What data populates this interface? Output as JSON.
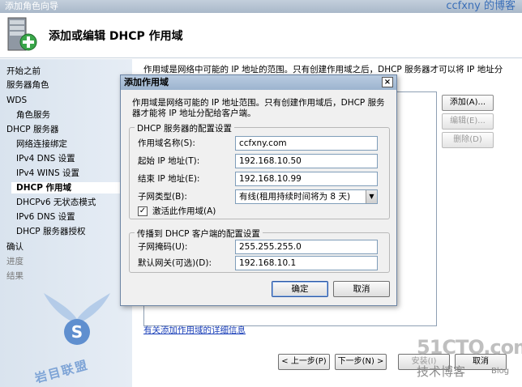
{
  "window": {
    "title": "添加角色向导",
    "watermark_top": "ccfxny 的博客"
  },
  "header": {
    "title": "添加或编辑 DHCP 作用域",
    "icon": "server-add-icon"
  },
  "nav": {
    "items": [
      {
        "label": "开始之前",
        "level": "top",
        "state": "normal"
      },
      {
        "label": "服务器角色",
        "level": "top",
        "state": "normal"
      },
      {
        "label": "WDS",
        "level": "top",
        "state": "normal"
      },
      {
        "label": "角色服务",
        "level": "sub",
        "state": "normal"
      },
      {
        "label": "DHCP 服务器",
        "level": "top",
        "state": "normal"
      },
      {
        "label": "网络连接绑定",
        "level": "sub",
        "state": "normal"
      },
      {
        "label": "IPv4 DNS 设置",
        "level": "sub",
        "state": "normal"
      },
      {
        "label": "IPv4 WINS 设置",
        "level": "sub",
        "state": "normal"
      },
      {
        "label": "DHCP 作用域",
        "level": "sub",
        "state": "active"
      },
      {
        "label": "DHCPv6 无状态模式",
        "level": "sub",
        "state": "normal"
      },
      {
        "label": "IPv6 DNS 设置",
        "level": "sub",
        "state": "normal"
      },
      {
        "label": "DHCP 服务器授权",
        "level": "sub",
        "state": "normal"
      },
      {
        "label": "确认",
        "level": "top",
        "state": "normal"
      },
      {
        "label": "进度",
        "level": "top",
        "state": "dim"
      },
      {
        "label": "结果",
        "level": "top",
        "state": "dim"
      }
    ]
  },
  "content": {
    "intro": "作用域是网络中可能的 IP 地址的范围。只有创建作用域之后，DHCP 服务器才可以将 IP 地址分",
    "buttons": {
      "add": "添加(A)...",
      "edit": "编辑(E)...",
      "delete": "删除(D)"
    },
    "more_link": "有关添加作用域的详细信息",
    "wizard_buttons": {
      "prev": "< 上一步(P)",
      "next": "下一步(N) >",
      "install": "安装(I)",
      "cancel": "取消"
    }
  },
  "dialog": {
    "title": "添加作用域",
    "description": "作用域是网络可能的 IP 地址范围。只有创建作用域后，DHCP 服务器才能将 IP 地址分配给客户端。",
    "group1": {
      "legend": "DHCP 服务器的配置设置",
      "scope_name_label": "作用域名称(S):",
      "scope_name_value": "ccfxny.com",
      "start_ip_label": "起始 IP 地址(T):",
      "start_ip_value": "192.168.10.50",
      "end_ip_label": "结束 IP 地址(E):",
      "end_ip_value": "192.168.10.99",
      "subnet_type_label": "子网类型(B):",
      "subnet_type_value": "有线(租用持续时间将为 8 天)",
      "activate_label": "激活此作用域(A)",
      "activate_checked": true
    },
    "group2": {
      "legend": "传播到 DHCP 客户端的配置设置",
      "mask_label": "子网掩码(U):",
      "mask_value": "255.255.255.0",
      "gateway_label": "默认网关(可选)(D):",
      "gateway_value": "192.168.10.1"
    },
    "ok": "确定",
    "cancel": "取消",
    "close_glyph": "×"
  },
  "watermarks": {
    "left_text": "岩目联盟",
    "right_big": "51CTO.com",
    "right_sub": "技术博客",
    "right_blog": "Blog"
  },
  "colors": {
    "link": "#1a3fb8",
    "nav_bg": "#d9e3ee",
    "dialog_title": "#9cb4cf"
  }
}
